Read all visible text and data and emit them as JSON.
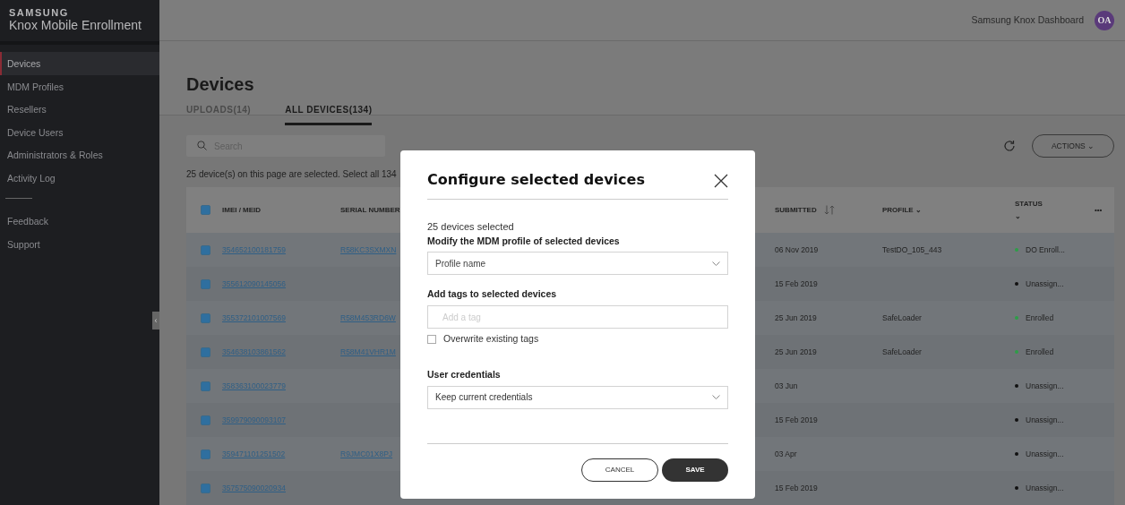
{
  "brand": {
    "company": "SAMSUNG",
    "product": "Knox Mobile Enrollment"
  },
  "sidebar": {
    "items": [
      {
        "label": "Devices",
        "selected": true
      },
      {
        "label": "MDM Profiles",
        "selected": false
      },
      {
        "label": "Resellers",
        "selected": false
      },
      {
        "label": "Device Users",
        "selected": false
      },
      {
        "label": "Administrators & Roles",
        "selected": false
      },
      {
        "label": "Activity Log",
        "selected": false
      }
    ],
    "footer_items": [
      {
        "label": "Feedback"
      },
      {
        "label": "Support"
      }
    ],
    "collapse_handle": "‹"
  },
  "header": {
    "link": "Samsung Knox Dashboard",
    "avatar": "OA"
  },
  "page": {
    "title": "Devices",
    "tabs": [
      {
        "label": "UPLOADS(14)",
        "selected": false
      },
      {
        "label": "ALL DEVICES(134)",
        "selected": true
      }
    ],
    "search": {
      "placeholder": "Search"
    },
    "actions": "ACTIONS ⌄",
    "selection_note": "25 device(s) on this page are selected.",
    "select_all_link": "Select all 134"
  },
  "table": {
    "all_checked": true,
    "columns": [
      "IMEI / MEID",
      "SERIAL NUMBER",
      "SUBMITTED",
      "PROFILE ⌄",
      "STATUS"
    ],
    "status_caret": "⌄",
    "more": "•••",
    "rows": [
      {
        "checked": true,
        "imei": "354652100181759",
        "serial": "R58KC3SXMXN",
        "submitted": "06 Nov 2019",
        "profile": "TestDO_105_443",
        "status": "DO Enroll...",
        "color": "#2e9e47"
      },
      {
        "checked": true,
        "imei": "355612090145056",
        "serial": "",
        "submitted": "15 Feb 2019",
        "profile": "",
        "status": "Unassign...",
        "color": "#111111"
      },
      {
        "checked": true,
        "imei": "355372101007569",
        "serial": "R58M453RD6W",
        "submitted": "25 Jun 2019",
        "profile": "SafeLoader",
        "status": "Enrolled",
        "color": "#2e9e47"
      },
      {
        "checked": true,
        "imei": "354638103861562",
        "serial": "R58M41VHR1M",
        "submitted": "25 Jun 2019",
        "profile": "SafeLoader",
        "status": "Enrolled",
        "color": "#2e9e47"
      },
      {
        "checked": true,
        "imei": "358363100023779",
        "serial": "",
        "submitted": "03 Jun",
        "profile": "",
        "status": "Unassign...",
        "color": "#111111"
      },
      {
        "checked": true,
        "imei": "359979090093107",
        "serial": "",
        "submitted": "15 Feb 2019",
        "profile": "",
        "status": "Unassign...",
        "color": "#111111"
      },
      {
        "checked": true,
        "imei": "359471101251502",
        "serial": "R9JMC01X8PJ",
        "submitted": "03 Apr",
        "profile": "",
        "status": "Unassign...",
        "color": "#111111"
      },
      {
        "checked": true,
        "imei": "357575090020934",
        "serial": "",
        "submitted": "15 Feb 2019",
        "profile": "",
        "status": "Unassign...",
        "color": "#111111"
      }
    ]
  },
  "dialog": {
    "title": "Configure selected devices",
    "count": "25 devices selected",
    "profile_label": "Modify the MDM profile of selected devices",
    "profile_placeholder": "Profile name",
    "tags_label": "Add tags to selected devices",
    "tags_placeholder": "Add a tag",
    "overwrite": {
      "label": "Overwrite existing tags",
      "checked": false
    },
    "credentials_label": "User credentials",
    "credentials_value": "Keep current credentials",
    "cancel": "CANCEL",
    "save": "SAVE"
  }
}
